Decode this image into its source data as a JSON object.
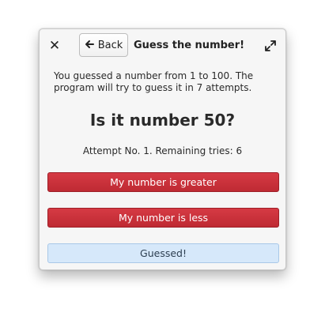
{
  "window": {
    "title": "Guess the number!",
    "close_icon": "close-icon",
    "expand_icon": "expand-icon"
  },
  "toolbar": {
    "back_label": "Back",
    "back_icon": "arrow-left-icon"
  },
  "main": {
    "description": "You guessed a number from 1 to 100. The program will try to guess it in 7 attempts.",
    "question": "Is it number 50?",
    "attempt_status": "Attempt No. 1. Remaining tries: 6"
  },
  "actions": {
    "greater_label": "My number is greater",
    "less_label": "My number is less",
    "guessed_label": "Guessed!"
  },
  "colors": {
    "danger": "#c8313b",
    "guessed_bg": "#d6e8fa"
  }
}
